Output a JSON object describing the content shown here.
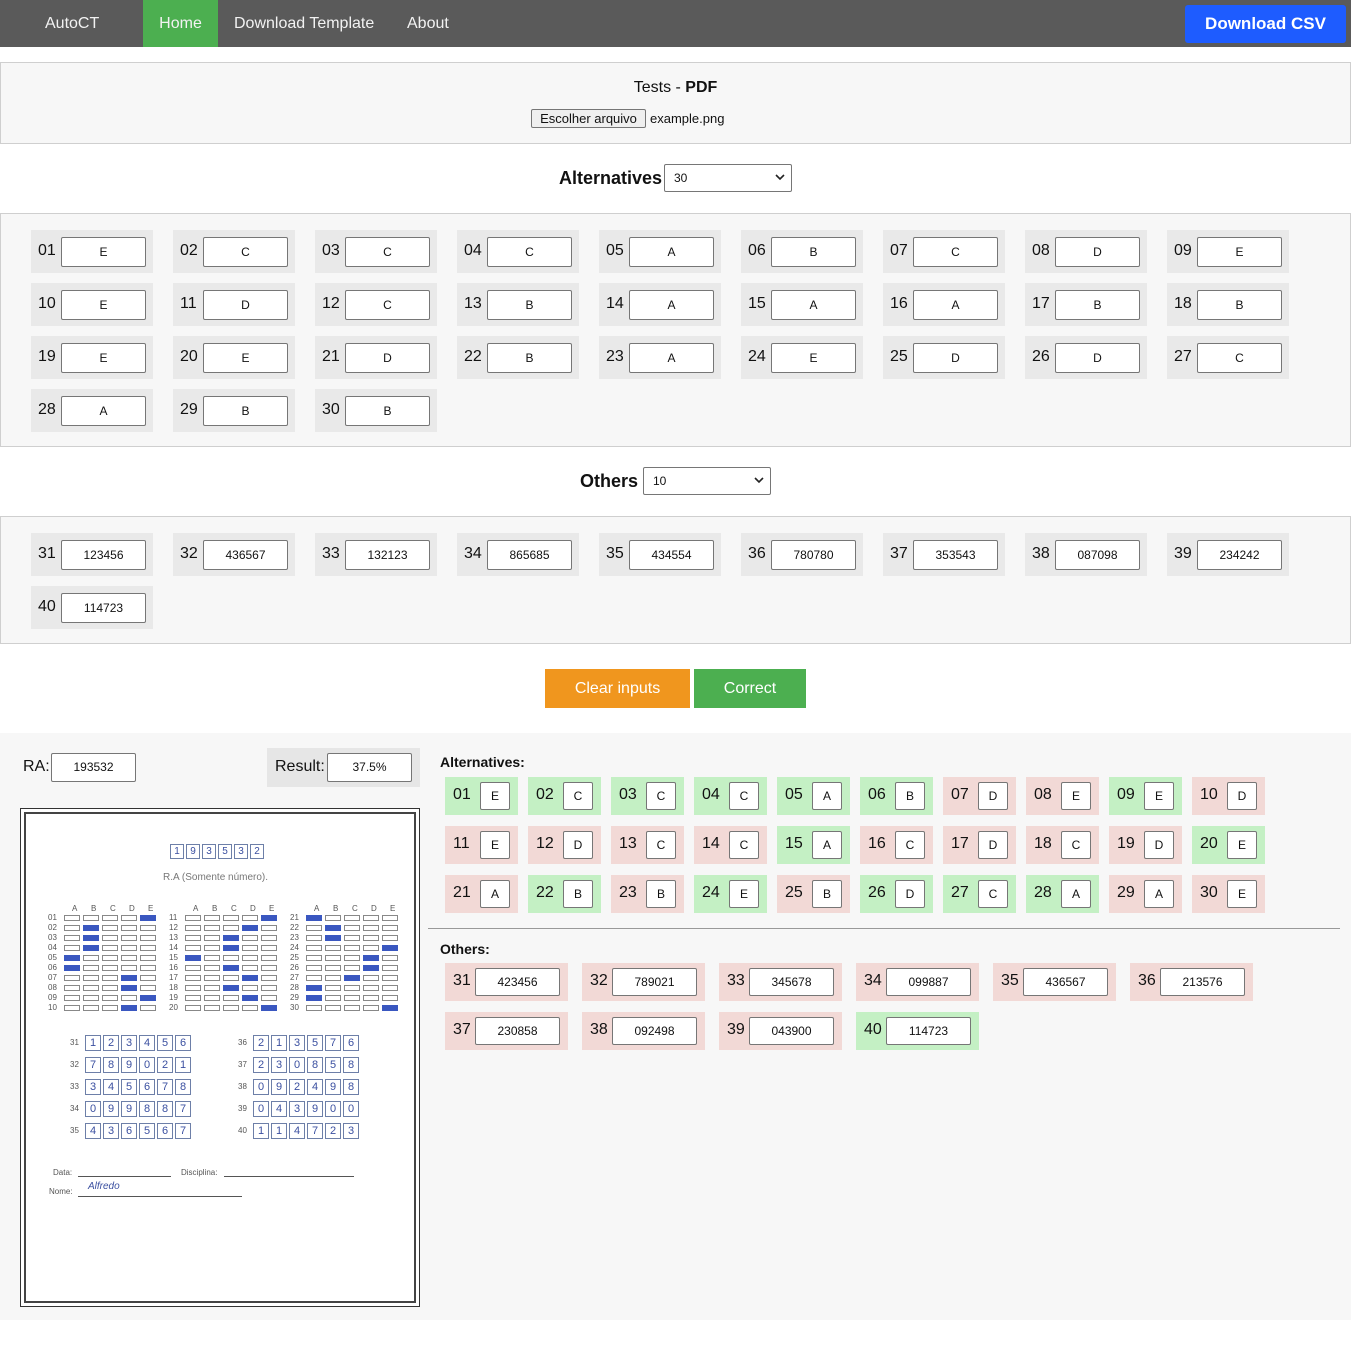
{
  "nav": {
    "brand": "AutoCT",
    "home": "Home",
    "template": "Download Template",
    "about": "About",
    "csv": "Download CSV"
  },
  "upload": {
    "title": "Tests - ",
    "title_bold": "PDF",
    "file_button": "Escolher arquivo",
    "file_name": "example.png"
  },
  "alternatives": {
    "label": "Alternatives",
    "count": "30",
    "items": [
      {
        "n": "01",
        "v": "E"
      },
      {
        "n": "02",
        "v": "C"
      },
      {
        "n": "03",
        "v": "C"
      },
      {
        "n": "04",
        "v": "C"
      },
      {
        "n": "05",
        "v": "A"
      },
      {
        "n": "06",
        "v": "B"
      },
      {
        "n": "07",
        "v": "C"
      },
      {
        "n": "08",
        "v": "D"
      },
      {
        "n": "09",
        "v": "E"
      },
      {
        "n": "10",
        "v": "E"
      },
      {
        "n": "11",
        "v": "D"
      },
      {
        "n": "12",
        "v": "C"
      },
      {
        "n": "13",
        "v": "B"
      },
      {
        "n": "14",
        "v": "A"
      },
      {
        "n": "15",
        "v": "A"
      },
      {
        "n": "16",
        "v": "A"
      },
      {
        "n": "17",
        "v": "B"
      },
      {
        "n": "18",
        "v": "B"
      },
      {
        "n": "19",
        "v": "E"
      },
      {
        "n": "20",
        "v": "E"
      },
      {
        "n": "21",
        "v": "D"
      },
      {
        "n": "22",
        "v": "B"
      },
      {
        "n": "23",
        "v": "A"
      },
      {
        "n": "24",
        "v": "E"
      },
      {
        "n": "25",
        "v": "D"
      },
      {
        "n": "26",
        "v": "D"
      },
      {
        "n": "27",
        "v": "C"
      },
      {
        "n": "28",
        "v": "A"
      },
      {
        "n": "29",
        "v": "B"
      },
      {
        "n": "30",
        "v": "B"
      }
    ]
  },
  "others": {
    "label": "Others",
    "count": "10",
    "items": [
      {
        "n": "31",
        "v": "123456"
      },
      {
        "n": "32",
        "v": "436567"
      },
      {
        "n": "33",
        "v": "132123"
      },
      {
        "n": "34",
        "v": "865685"
      },
      {
        "n": "35",
        "v": "434554"
      },
      {
        "n": "36",
        "v": "780780"
      },
      {
        "n": "37",
        "v": "353543"
      },
      {
        "n": "38",
        "v": "087098"
      },
      {
        "n": "39",
        "v": "234242"
      },
      {
        "n": "40",
        "v": "114723"
      }
    ]
  },
  "buttons": {
    "clear": "Clear inputs",
    "correct": "Correct"
  },
  "result": {
    "ra_label": "RA:",
    "ra_value": "193532",
    "result_label": "Result:",
    "result_value": "37.5%",
    "alternatives_head": "Alternatives:",
    "others_head": "Others:",
    "alternatives": [
      {
        "n": "01",
        "v": "E",
        "ok": true
      },
      {
        "n": "02",
        "v": "C",
        "ok": true
      },
      {
        "n": "03",
        "v": "C",
        "ok": true
      },
      {
        "n": "04",
        "v": "C",
        "ok": true
      },
      {
        "n": "05",
        "v": "A",
        "ok": true
      },
      {
        "n": "06",
        "v": "B",
        "ok": true
      },
      {
        "n": "07",
        "v": "D",
        "ok": false
      },
      {
        "n": "08",
        "v": "E",
        "ok": false
      },
      {
        "n": "09",
        "v": "E",
        "ok": true
      },
      {
        "n": "10",
        "v": "D",
        "ok": false
      },
      {
        "n": "11",
        "v": "E",
        "ok": false
      },
      {
        "n": "12",
        "v": "D",
        "ok": false
      },
      {
        "n": "13",
        "v": "C",
        "ok": false
      },
      {
        "n": "14",
        "v": "C",
        "ok": false
      },
      {
        "n": "15",
        "v": "A",
        "ok": true
      },
      {
        "n": "16",
        "v": "C",
        "ok": false
      },
      {
        "n": "17",
        "v": "D",
        "ok": false
      },
      {
        "n": "18",
        "v": "C",
        "ok": false
      },
      {
        "n": "19",
        "v": "D",
        "ok": false
      },
      {
        "n": "20",
        "v": "E",
        "ok": true
      },
      {
        "n": "21",
        "v": "A",
        "ok": false
      },
      {
        "n": "22",
        "v": "B",
        "ok": true
      },
      {
        "n": "23",
        "v": "B",
        "ok": false
      },
      {
        "n": "24",
        "v": "E",
        "ok": true
      },
      {
        "n": "25",
        "v": "B",
        "ok": false
      },
      {
        "n": "26",
        "v": "D",
        "ok": true
      },
      {
        "n": "27",
        "v": "C",
        "ok": true
      },
      {
        "n": "28",
        "v": "A",
        "ok": true
      },
      {
        "n": "29",
        "v": "A",
        "ok": false
      },
      {
        "n": "30",
        "v": "E",
        "ok": false
      }
    ],
    "others": [
      {
        "n": "31",
        "v": "423456",
        "ok": false
      },
      {
        "n": "32",
        "v": "789021",
        "ok": false
      },
      {
        "n": "33",
        "v": "345678",
        "ok": false
      },
      {
        "n": "34",
        "v": "099887",
        "ok": false
      },
      {
        "n": "35",
        "v": "436567",
        "ok": false
      },
      {
        "n": "36",
        "v": "213576",
        "ok": false
      },
      {
        "n": "37",
        "v": "230858",
        "ok": false
      },
      {
        "n": "38",
        "v": "092498",
        "ok": false
      },
      {
        "n": "39",
        "v": "043900",
        "ok": false
      },
      {
        "n": "40",
        "v": "114723",
        "ok": true
      }
    ]
  },
  "sheet": {
    "ra_digits": [
      "1",
      "9",
      "3",
      "5",
      "3",
      "2"
    ],
    "ra_caption": "R.A (Somente número).",
    "letters": [
      "A",
      "B",
      "C",
      "D",
      "E"
    ],
    "marks": [
      5,
      2,
      2,
      2,
      1,
      1,
      4,
      4,
      5,
      4,
      5,
      4,
      3,
      3,
      1,
      3,
      4,
      3,
      4,
      5,
      1,
      2,
      2,
      5,
      4,
      4,
      3,
      1,
      1,
      5
    ],
    "numeric": [
      {
        "n": "31",
        "d": [
          "1",
          "2",
          "3",
          "4",
          "5",
          "6"
        ]
      },
      {
        "n": "32",
        "d": [
          "7",
          "8",
          "9",
          "0",
          "2",
          "1"
        ]
      },
      {
        "n": "33",
        "d": [
          "3",
          "4",
          "5",
          "6",
          "7",
          "8"
        ]
      },
      {
        "n": "34",
        "d": [
          "0",
          "9",
          "9",
          "8",
          "8",
          "7"
        ]
      },
      {
        "n": "35",
        "d": [
          "4",
          "3",
          "6",
          "5",
          "6",
          "7"
        ]
      },
      {
        "n": "36",
        "d": [
          "2",
          "1",
          "3",
          "5",
          "7",
          "6"
        ]
      },
      {
        "n": "37",
        "d": [
          "2",
          "3",
          "0",
          "8",
          "5",
          "8"
        ]
      },
      {
        "n": "38",
        "d": [
          "0",
          "9",
          "2",
          "4",
          "9",
          "8"
        ]
      },
      {
        "n": "39",
        "d": [
          "0",
          "4",
          "3",
          "9",
          "0",
          "0"
        ]
      },
      {
        "n": "40",
        "d": [
          "1",
          "1",
          "4",
          "7",
          "2",
          "3"
        ]
      }
    ],
    "data_label": "Data:",
    "disciplina_label": "Disciplina:",
    "nome_label": "Nome:",
    "signature": "Alfredo"
  }
}
